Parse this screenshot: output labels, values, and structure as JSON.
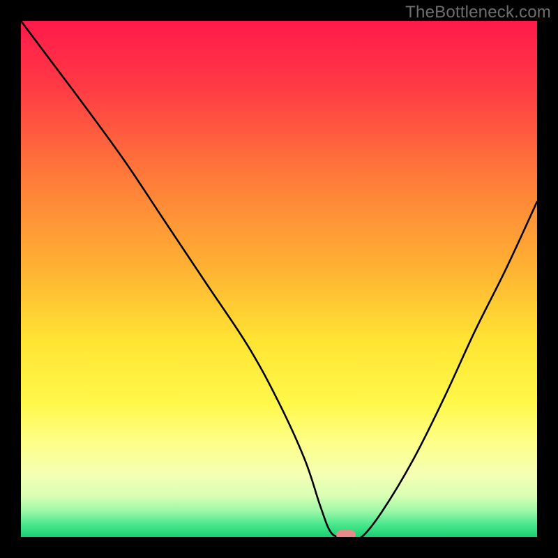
{
  "watermark": "TheBottleneck.com",
  "chart_data": {
    "type": "line",
    "title": "",
    "xlabel": "",
    "ylabel": "",
    "xlim": [
      0,
      100
    ],
    "ylim": [
      0,
      100
    ],
    "series": [
      {
        "name": "bottleneck-curve",
        "x": [
          0,
          6,
          12,
          20,
          28,
          36,
          44,
          50,
          55,
          58,
          60,
          62,
          64,
          66,
          70,
          76,
          82,
          88,
          94,
          100
        ],
        "values": [
          100,
          92,
          84,
          73,
          61,
          49,
          37,
          26,
          15,
          6,
          1,
          0,
          0,
          0,
          5,
          15,
          27,
          40,
          52,
          65
        ]
      }
    ],
    "marker": {
      "x": 63,
      "y": 0
    },
    "gradient_stops": [
      {
        "pos": 0.0,
        "color": "#ff1a4b"
      },
      {
        "pos": 0.12,
        "color": "#ff3845"
      },
      {
        "pos": 0.3,
        "color": "#ff7a3a"
      },
      {
        "pos": 0.48,
        "color": "#ffb233"
      },
      {
        "pos": 0.62,
        "color": "#ffe433"
      },
      {
        "pos": 0.74,
        "color": "#fff84a"
      },
      {
        "pos": 0.82,
        "color": "#fdff8a"
      },
      {
        "pos": 0.88,
        "color": "#f4ffb4"
      },
      {
        "pos": 0.92,
        "color": "#d8ffb4"
      },
      {
        "pos": 0.95,
        "color": "#9cf7a8"
      },
      {
        "pos": 0.975,
        "color": "#4be88e"
      },
      {
        "pos": 1.0,
        "color": "#18d070"
      }
    ]
  }
}
